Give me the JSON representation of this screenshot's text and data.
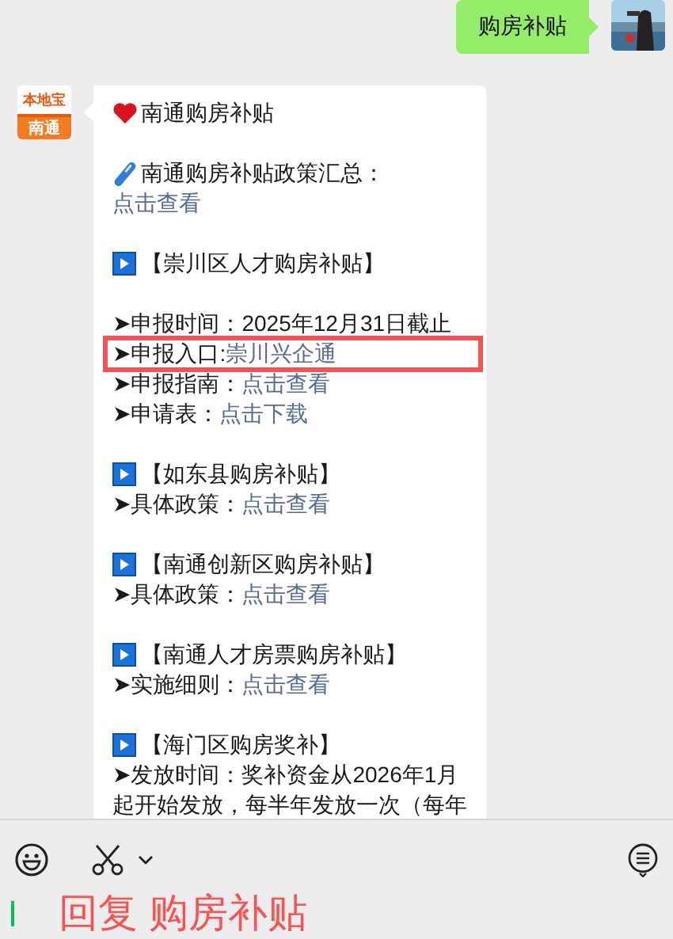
{
  "sent_message": {
    "text": "购房补贴"
  },
  "received_message": {
    "logo": {
      "top": "本地宝",
      "bottom": "南通"
    },
    "lines": [
      {
        "kind": "heart-title",
        "text": "南通购房补贴"
      },
      {
        "kind": "blank"
      },
      {
        "kind": "pill-title",
        "text": "南通购房补贴政策汇总："
      },
      {
        "kind": "link",
        "text": "点击查看"
      },
      {
        "kind": "blank"
      },
      {
        "kind": "section",
        "text": "【崇川区人才购房补贴】"
      },
      {
        "kind": "blank"
      },
      {
        "kind": "item",
        "label": "➤申报时间：2025年12月31日截止",
        "highlighted": false
      },
      {
        "kind": "item",
        "label": "➤申报入口:",
        "link": "崇川兴企通",
        "highlighted": true
      },
      {
        "kind": "item",
        "label": "➤申报指南：",
        "link": "点击查看",
        "highlighted": false
      },
      {
        "kind": "item",
        "label": "➤申请表：",
        "link": "点击下载",
        "highlighted": false
      },
      {
        "kind": "blank"
      },
      {
        "kind": "section",
        "text": "【如东县购房补贴】"
      },
      {
        "kind": "item",
        "label": "➤具体政策：",
        "link": "点击查看",
        "highlighted": false
      },
      {
        "kind": "blank"
      },
      {
        "kind": "section",
        "text": "【南通创新区购房补贴】"
      },
      {
        "kind": "item",
        "label": "➤具体政策：",
        "link": "点击查看",
        "highlighted": false
      },
      {
        "kind": "blank"
      },
      {
        "kind": "section",
        "text": "【南通人才房票购房补贴】"
      },
      {
        "kind": "item",
        "label": "➤实施细则：",
        "link": "点击查看",
        "highlighted": false
      },
      {
        "kind": "blank"
      },
      {
        "kind": "section",
        "text": "【海门区购房奖补】"
      },
      {
        "kind": "text",
        "text": "➤发放时间：奖补资金从2026年1月起开始发放，每半年发放一次（每年"
      }
    ]
  },
  "input": {
    "value": "回复 购房补贴"
  }
}
